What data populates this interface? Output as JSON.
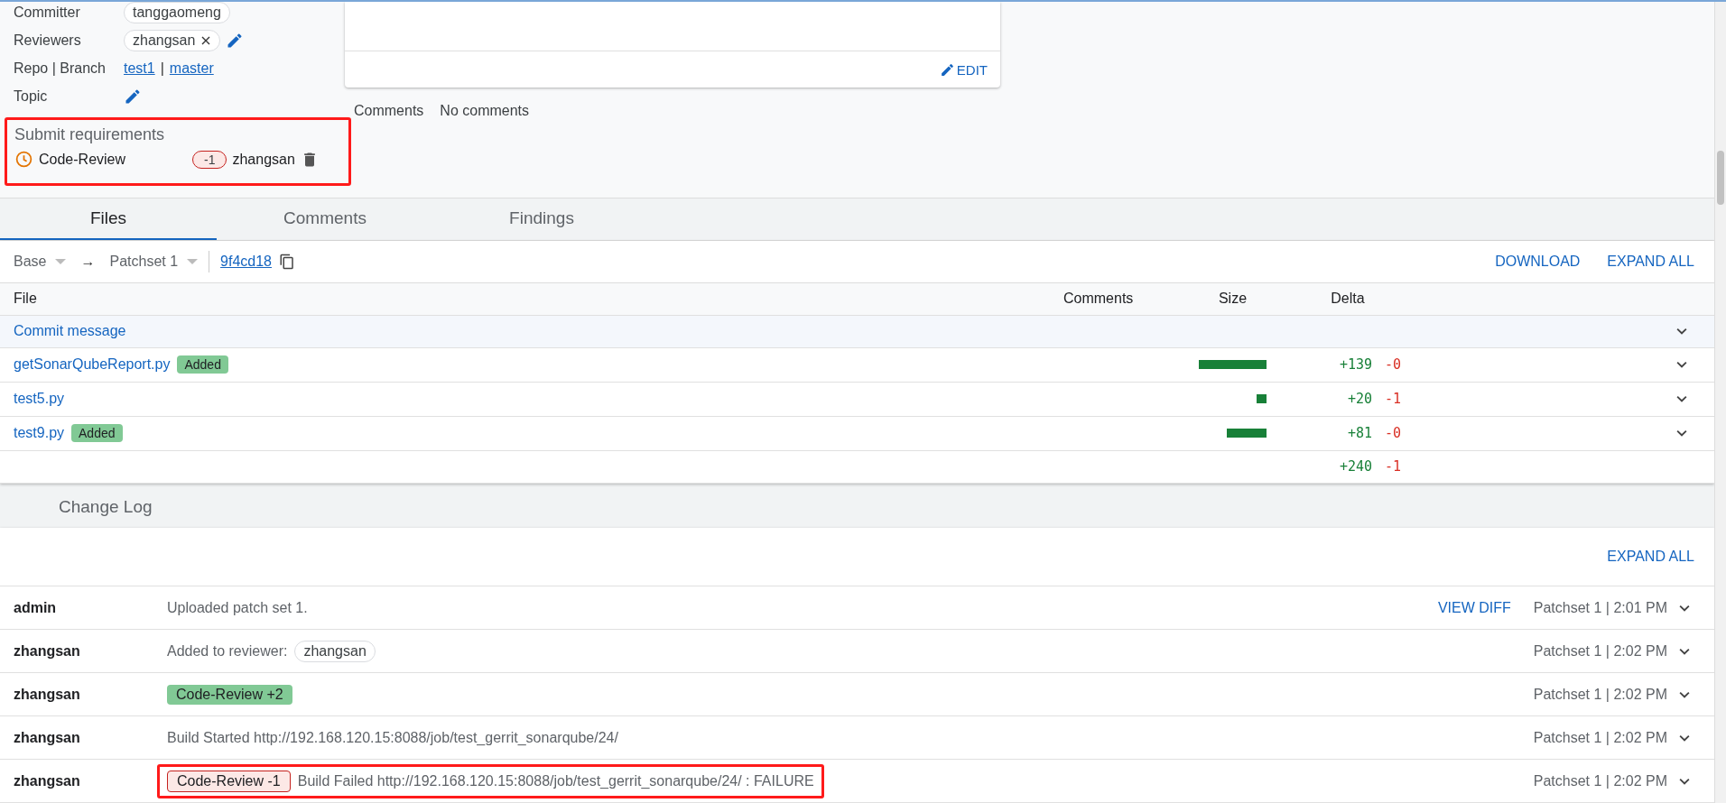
{
  "meta": [
    {
      "label": "Committer",
      "kind": "chip",
      "value": "tanggaomeng"
    },
    {
      "label": "Reviewers",
      "kind": "removable_chip",
      "value": "zhangsan"
    },
    {
      "label": "Repo | Branch",
      "kind": "links",
      "repo": "test1",
      "separator": "|",
      "branch": "master"
    },
    {
      "label": "Topic",
      "kind": "edit"
    }
  ],
  "commit_message": {
    "edit": "EDIT"
  },
  "comments_summary": {
    "label": "Comments",
    "value": "No comments"
  },
  "submit_requirements": {
    "title": "Submit requirements",
    "highlighted": true,
    "items": [
      {
        "name": "Code-Review",
        "vote": "-1",
        "positive": false,
        "voter": "zhangsan"
      }
    ]
  },
  "tabs": [
    {
      "label": "Files",
      "selected": true
    },
    {
      "label": "Comments",
      "selected": false
    },
    {
      "label": "Findings",
      "selected": false
    }
  ],
  "toolbar": {
    "base": "Base",
    "arrow": "→",
    "patchset": "Patchset 1",
    "commit": "9f4cd18",
    "actions": [
      "DOWNLOAD",
      "EXPAND ALL"
    ]
  },
  "files": {
    "columns": [
      "File",
      "Comments",
      "Size",
      "Delta"
    ],
    "rows": [
      {
        "name": "Commit message",
        "kind": "message"
      },
      {
        "name": "getSonarQubeReport.py",
        "status": "Added",
        "added": "+139",
        "removed": "-0"
      },
      {
        "name": "test5.py",
        "added": "+20",
        "removed": "-1"
      },
      {
        "name": "test9.py",
        "status": "Added",
        "added": "+81",
        "removed": "-0"
      }
    ],
    "total": {
      "added": "+240",
      "removed": "-1"
    }
  },
  "change_log": {
    "title": "Change Log",
    "expand_all": "EXPAND ALL",
    "entries": [
      {
        "author": "admin",
        "highlighted": false,
        "parts": [
          {
            "kind": "text",
            "text": "Uploaded patch set 1."
          }
        ],
        "action": "VIEW DIFF",
        "meta": "Patchset 1 | 2:01 PM"
      },
      {
        "author": "zhangsan",
        "highlighted": false,
        "parts": [
          {
            "kind": "text",
            "text": "Added to reviewer:"
          },
          {
            "kind": "chip",
            "text": "zhangsan"
          }
        ],
        "meta": "Patchset 1 | 2:02 PM"
      },
      {
        "author": "zhangsan",
        "highlighted": false,
        "parts": [
          {
            "kind": "vote",
            "text": "Code-Review +2",
            "positive": true
          }
        ],
        "meta": "Patchset 1 | 2:02 PM"
      },
      {
        "author": "zhangsan",
        "highlighted": false,
        "parts": [
          {
            "kind": "text",
            "text": "Build Started http://192.168.120.15:8088/job/test_gerrit_sonarqube/24/"
          }
        ],
        "meta": "Patchset 1 | 2:02 PM"
      },
      {
        "author": "zhangsan",
        "highlighted": true,
        "parts": [
          {
            "kind": "vote",
            "text": "Code-Review -1",
            "positive": false
          },
          {
            "kind": "text",
            "text": "Build Failed http://192.168.120.15:8088/job/test_gerrit_sonarqube/24/ : FAILURE"
          }
        ],
        "meta": "Patchset 1 | 2:02 PM"
      }
    ]
  }
}
